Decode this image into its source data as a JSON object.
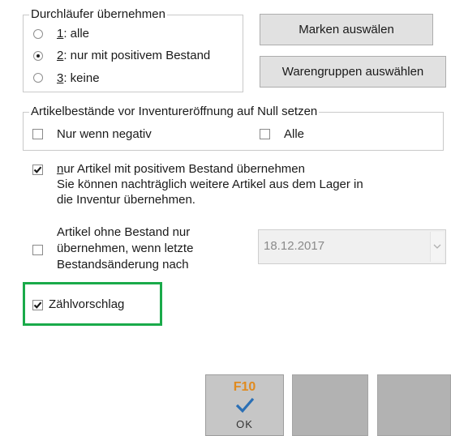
{
  "durchlaeufer": {
    "legend": "Durchläufer übernehmen",
    "options": [
      {
        "key": "1",
        "rest": ": alle",
        "checked": false
      },
      {
        "key": "2",
        "rest": ": nur mit positivem Bestand",
        "checked": true
      },
      {
        "key": "3",
        "rest": ": keine",
        "checked": false
      }
    ]
  },
  "buttons": {
    "marken": "Marken auswälen",
    "warengruppen": "Warengruppen auswählen"
  },
  "null_setzen": {
    "legend": "Artikelbestände vor Inventureröffnung auf Null setzen",
    "nur_negativ": {
      "label": "Nur wenn negativ",
      "checked": false
    },
    "alle": {
      "label": "Alle",
      "checked": false
    }
  },
  "positiv_bestand": {
    "checked": true,
    "first_char": "n",
    "line1_rest": "ur Artikel mit positivem Bestand übernehmen",
    "line2": "Sie können nachträglich weitere Artikel aus dem Lager in",
    "line3": "die Inventur übernehmen."
  },
  "ohne_bestand": {
    "checked": false,
    "line1": "Artikel ohne Bestand nur",
    "line2": "übernehmen, wenn letzte",
    "line3": "Bestandsänderung nach",
    "date": "18.12.2017"
  },
  "zaehlvorschlag": {
    "label": "Zählvorschlag",
    "checked": true
  },
  "ok_button": {
    "key": "F10",
    "label": "OK"
  },
  "colors": {
    "highlight": "#1aaa4a",
    "f10": "#e08a1e",
    "check": "#2a6fb5"
  }
}
